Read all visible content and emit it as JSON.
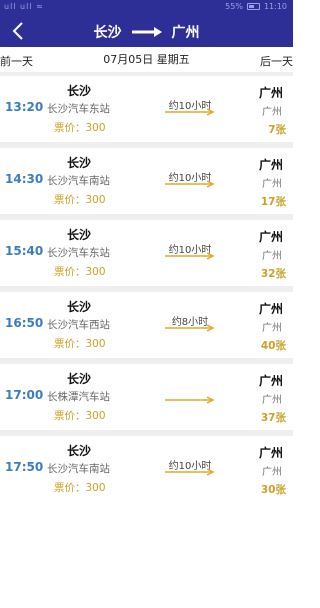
{
  "status_bar": {
    "left": "ull ull ≈",
    "battery_percent": "55%",
    "time": "11:10"
  },
  "header": {
    "origin": "长沙",
    "destination": "广州"
  },
  "date_bar": {
    "prev_label": "前一天",
    "date": "07月05日  星期五",
    "next_label": "后一天"
  },
  "trips": [
    {
      "time": "13:20",
      "from": "长沙",
      "station": "长沙汽车东站",
      "price": "票价：300",
      "duration": "约10小时",
      "to": "广州",
      "to_city": "广州",
      "seats": "7张"
    },
    {
      "time": "14:30",
      "from": "长沙",
      "station": "长沙汽车南站",
      "price": "票价：300",
      "duration": "约10小时",
      "to": "广州",
      "to_city": "广州",
      "seats": "17张"
    },
    {
      "time": "15:40",
      "from": "长沙",
      "station": "长沙汽车东站",
      "price": "票价：300",
      "duration": "约10小时",
      "to": "广州",
      "to_city": "广州",
      "seats": "32张"
    },
    {
      "time": "16:50",
      "from": "长沙",
      "station": "长沙汽车西站",
      "price": "票价：300",
      "duration": "约8小时",
      "to": "广州",
      "to_city": "广州",
      "seats": "40张"
    },
    {
      "time": "17:00",
      "from": "长沙",
      "station": "长株潭汽车站",
      "price": "票价：300",
      "duration": "",
      "to": "广州",
      "to_city": "广州",
      "seats": "37张"
    },
    {
      "time": "17:50",
      "from": "长沙",
      "station": "长沙汽车南站",
      "price": "票价：300",
      "duration": "约10小时",
      "to": "广州",
      "to_city": "广州",
      "seats": "30张"
    }
  ],
  "colors": {
    "header_bg": "#2d2f96",
    "time": "#3a7dbf",
    "price": "#c9a227",
    "arrow": "#e0a92a"
  },
  "icons": {
    "back": "chevron-left-icon",
    "route_arrow": "arrow-right-icon",
    "trip_arrow": "arrow-right-icon"
  }
}
